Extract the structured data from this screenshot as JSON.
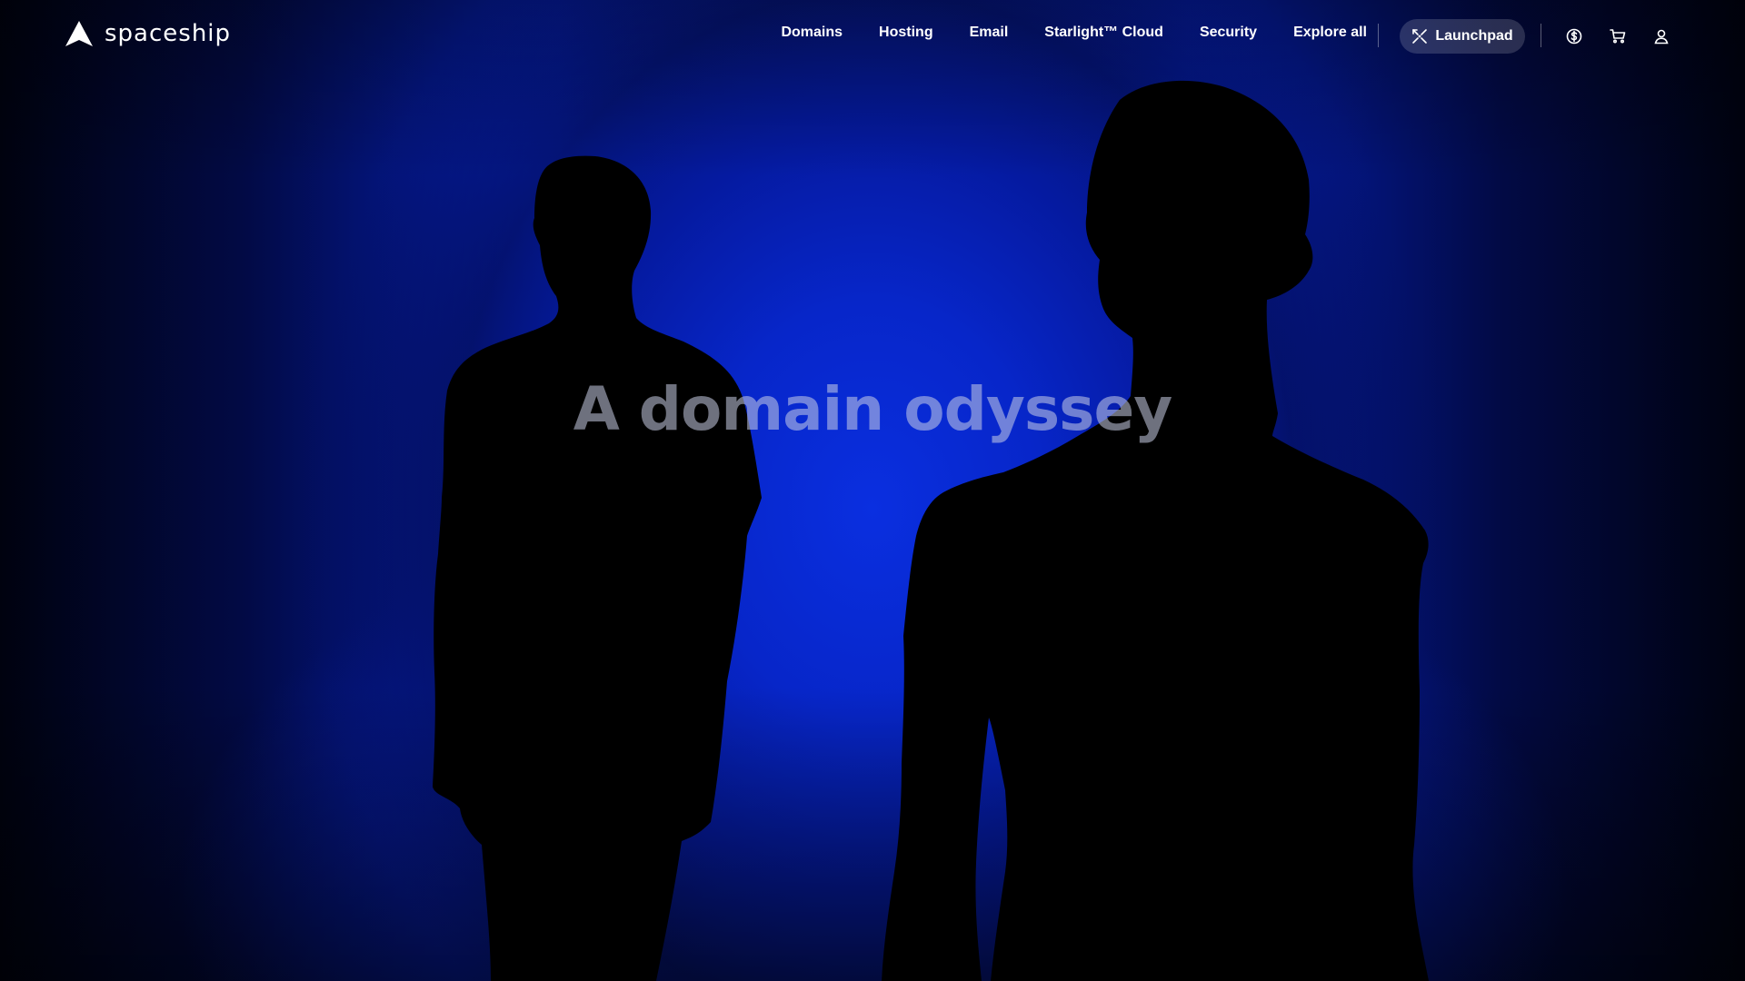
{
  "brand": {
    "name": "spaceship",
    "logo_icon": "spaceship-logo-icon"
  },
  "nav": {
    "items": [
      {
        "label": "Domains"
      },
      {
        "label": "Hosting"
      },
      {
        "label": "Email"
      },
      {
        "label": "Starlight™ Cloud"
      },
      {
        "label": "Security"
      },
      {
        "label": "Explore all"
      }
    ],
    "launchpad": {
      "label": "Launchpad",
      "icon": "launchpad-icon"
    },
    "icons": [
      "currency-icon",
      "cart-icon",
      "account-icon"
    ]
  },
  "hero": {
    "headline": "A domain odyssey"
  },
  "colors": {
    "background": "#00020f",
    "accent_blue": "#0726cc",
    "headline": "#c8cde6",
    "nav_text": "#ffffff"
  }
}
